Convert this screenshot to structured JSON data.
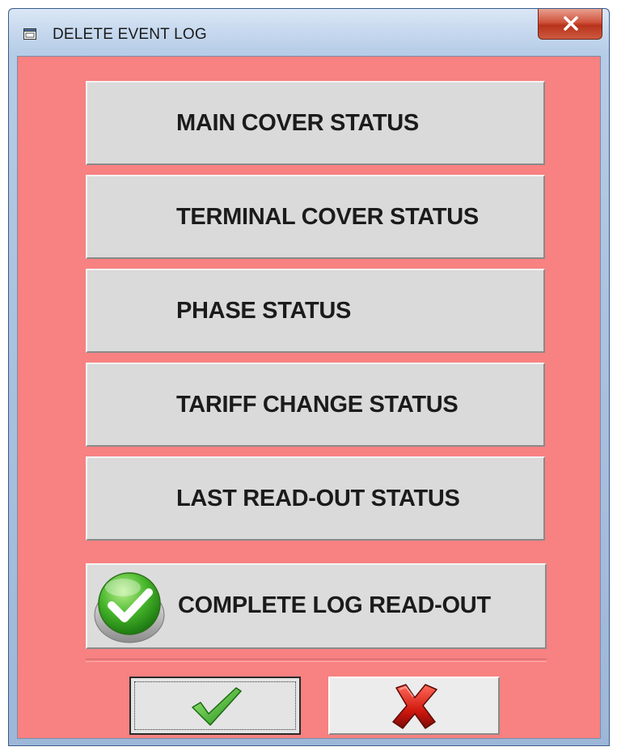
{
  "window": {
    "title": "DELETE EVENT LOG",
    "icons": {
      "app": "window-app-icon",
      "close": "close-x-icon"
    },
    "colors": {
      "client_background": "#f88181",
      "button_face": "#dadada"
    }
  },
  "menu": {
    "items": [
      {
        "label": "MAIN COVER STATUS"
      },
      {
        "label": "TERMINAL COVER STATUS"
      },
      {
        "label": "PHASE STATUS"
      },
      {
        "label": "TARIFF CHANGE STATUS"
      },
      {
        "label": "LAST READ-OUT STATUS"
      }
    ],
    "complete": {
      "label": "COMPLETE LOG READ-OUT",
      "icon": "green-check-badge-icon"
    }
  },
  "actions": {
    "ok": {
      "icon": "green-checkmark-icon"
    },
    "cancel": {
      "icon": "red-x-icon"
    }
  }
}
